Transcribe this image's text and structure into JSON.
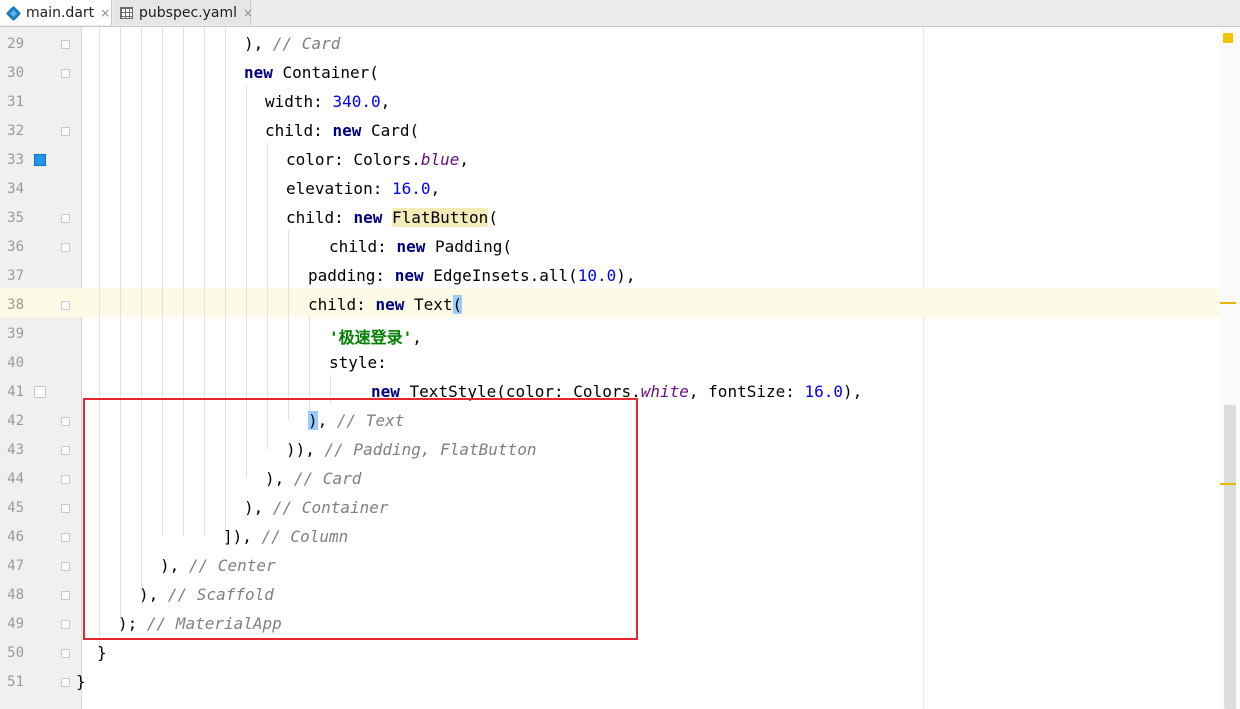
{
  "tabs": [
    {
      "label": "main.dart",
      "icon": "dart-file-icon",
      "active": true
    },
    {
      "label": "pubspec.yaml",
      "icon": "yaml-file-icon",
      "active": false
    }
  ],
  "close_glyph": "×",
  "line_numbers": [
    "29",
    "30",
    "31",
    "32",
    "33",
    "34",
    "35",
    "36",
    "37",
    "38",
    "39",
    "40",
    "41",
    "42",
    "43",
    "44",
    "45",
    "46",
    "47",
    "48",
    "49",
    "50",
    "51"
  ],
  "code": {
    "l29": {
      "a": "), ",
      "c": "// Card"
    },
    "l30": {
      "kw": "new",
      "b": " Container("
    },
    "l31": {
      "a": "width: ",
      "num": "340.0",
      "b": ","
    },
    "l32": {
      "a": "child: ",
      "kw": "new",
      "b": " Card("
    },
    "l33": {
      "a": "color: Colors.",
      "it": "blue",
      "b": ","
    },
    "l34": {
      "a": "elevation: ",
      "num": "16.0",
      "b": ","
    },
    "l35": {
      "a": "child: ",
      "kw": "new",
      "sp": " ",
      "fn": "FlatButton",
      "b": "("
    },
    "l36": {
      "a": "child: ",
      "kw": "new",
      "b": " Padding("
    },
    "l37": {
      "a": "padding: ",
      "kw": "new",
      "b": " EdgeInsets.all(",
      "num": "10.0",
      "d": "),"
    },
    "l38": {
      "a": "child: ",
      "kw": "new",
      "b": " Text",
      "br": "("
    },
    "l39": {
      "str": "'极速登录'",
      "b": ","
    },
    "l40": {
      "a": "style:"
    },
    "l41": {
      "kw": "new",
      "b": " TextStyle(color: Colors.",
      "it": "white",
      "d": ", fontSize: ",
      "num": "16.0",
      "e": "),"
    },
    "l42": {
      "br": ")",
      "a": ", ",
      "c": "// Text"
    },
    "l43": {
      "a": ")), ",
      "c": "// Padding, FlatButton"
    },
    "l44": {
      "a": "), ",
      "c": "// Card"
    },
    "l45": {
      "a": "), ",
      "c": "// Container"
    },
    "l46": {
      "a": "]), ",
      "c": "// Column"
    },
    "l47": {
      "a": "), ",
      "c": "// Center"
    },
    "l48": {
      "a": "), ",
      "c": "// Scaffold"
    },
    "l49": {
      "a": "); ",
      "c": "// MaterialApp"
    },
    "l50": {
      "a": "}"
    },
    "l51": {
      "a": "}"
    }
  },
  "colors": {
    "keyword": "#000080",
    "number": "#0000ff",
    "field_italic": "#660e7a",
    "comment": "#808080",
    "string": "#008000",
    "highlight_box": "#e3292f",
    "current_line": "#fdfbe5"
  }
}
